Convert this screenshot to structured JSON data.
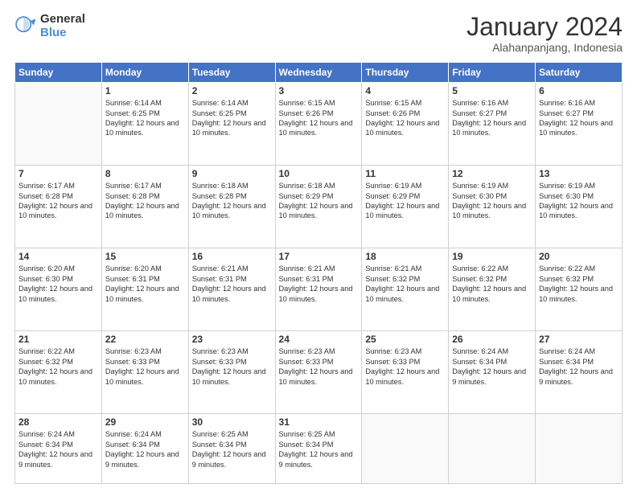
{
  "header": {
    "logo_general": "General",
    "logo_blue": "Blue",
    "month_title": "January 2024",
    "subtitle": "Alahanpanjang, Indonesia"
  },
  "weekdays": [
    "Sunday",
    "Monday",
    "Tuesday",
    "Wednesday",
    "Thursday",
    "Friday",
    "Saturday"
  ],
  "weeks": [
    [
      {
        "day": "",
        "empty": true
      },
      {
        "day": "1",
        "sunrise": "6:14 AM",
        "sunset": "6:25 PM",
        "daylight": "12 hours and 10 minutes."
      },
      {
        "day": "2",
        "sunrise": "6:14 AM",
        "sunset": "6:25 PM",
        "daylight": "12 hours and 10 minutes."
      },
      {
        "day": "3",
        "sunrise": "6:15 AM",
        "sunset": "6:26 PM",
        "daylight": "12 hours and 10 minutes."
      },
      {
        "day": "4",
        "sunrise": "6:15 AM",
        "sunset": "6:26 PM",
        "daylight": "12 hours and 10 minutes."
      },
      {
        "day": "5",
        "sunrise": "6:16 AM",
        "sunset": "6:27 PM",
        "daylight": "12 hours and 10 minutes."
      },
      {
        "day": "6",
        "sunrise": "6:16 AM",
        "sunset": "6:27 PM",
        "daylight": "12 hours and 10 minutes."
      }
    ],
    [
      {
        "day": "7",
        "sunrise": "6:17 AM",
        "sunset": "6:28 PM",
        "daylight": "12 hours and 10 minutes."
      },
      {
        "day": "8",
        "sunrise": "6:17 AM",
        "sunset": "6:28 PM",
        "daylight": "12 hours and 10 minutes."
      },
      {
        "day": "9",
        "sunrise": "6:18 AM",
        "sunset": "6:28 PM",
        "daylight": "12 hours and 10 minutes."
      },
      {
        "day": "10",
        "sunrise": "6:18 AM",
        "sunset": "6:29 PM",
        "daylight": "12 hours and 10 minutes."
      },
      {
        "day": "11",
        "sunrise": "6:19 AM",
        "sunset": "6:29 PM",
        "daylight": "12 hours and 10 minutes."
      },
      {
        "day": "12",
        "sunrise": "6:19 AM",
        "sunset": "6:30 PM",
        "daylight": "12 hours and 10 minutes."
      },
      {
        "day": "13",
        "sunrise": "6:19 AM",
        "sunset": "6:30 PM",
        "daylight": "12 hours and 10 minutes."
      }
    ],
    [
      {
        "day": "14",
        "sunrise": "6:20 AM",
        "sunset": "6:30 PM",
        "daylight": "12 hours and 10 minutes."
      },
      {
        "day": "15",
        "sunrise": "6:20 AM",
        "sunset": "6:31 PM",
        "daylight": "12 hours and 10 minutes."
      },
      {
        "day": "16",
        "sunrise": "6:21 AM",
        "sunset": "6:31 PM",
        "daylight": "12 hours and 10 minutes."
      },
      {
        "day": "17",
        "sunrise": "6:21 AM",
        "sunset": "6:31 PM",
        "daylight": "12 hours and 10 minutes."
      },
      {
        "day": "18",
        "sunrise": "6:21 AM",
        "sunset": "6:32 PM",
        "daylight": "12 hours and 10 minutes."
      },
      {
        "day": "19",
        "sunrise": "6:22 AM",
        "sunset": "6:32 PM",
        "daylight": "12 hours and 10 minutes."
      },
      {
        "day": "20",
        "sunrise": "6:22 AM",
        "sunset": "6:32 PM",
        "daylight": "12 hours and 10 minutes."
      }
    ],
    [
      {
        "day": "21",
        "sunrise": "6:22 AM",
        "sunset": "6:32 PM",
        "daylight": "12 hours and 10 minutes."
      },
      {
        "day": "22",
        "sunrise": "6:23 AM",
        "sunset": "6:33 PM",
        "daylight": "12 hours and 10 minutes."
      },
      {
        "day": "23",
        "sunrise": "6:23 AM",
        "sunset": "6:33 PM",
        "daylight": "12 hours and 10 minutes."
      },
      {
        "day": "24",
        "sunrise": "6:23 AM",
        "sunset": "6:33 PM",
        "daylight": "12 hours and 10 minutes."
      },
      {
        "day": "25",
        "sunrise": "6:23 AM",
        "sunset": "6:33 PM",
        "daylight": "12 hours and 10 minutes."
      },
      {
        "day": "26",
        "sunrise": "6:24 AM",
        "sunset": "6:34 PM",
        "daylight": "12 hours and 9 minutes."
      },
      {
        "day": "27",
        "sunrise": "6:24 AM",
        "sunset": "6:34 PM",
        "daylight": "12 hours and 9 minutes."
      }
    ],
    [
      {
        "day": "28",
        "sunrise": "6:24 AM",
        "sunset": "6:34 PM",
        "daylight": "12 hours and 9 minutes."
      },
      {
        "day": "29",
        "sunrise": "6:24 AM",
        "sunset": "6:34 PM",
        "daylight": "12 hours and 9 minutes."
      },
      {
        "day": "30",
        "sunrise": "6:25 AM",
        "sunset": "6:34 PM",
        "daylight": "12 hours and 9 minutes."
      },
      {
        "day": "31",
        "sunrise": "6:25 AM",
        "sunset": "6:34 PM",
        "daylight": "12 hours and 9 minutes."
      },
      {
        "day": "",
        "empty": true
      },
      {
        "day": "",
        "empty": true
      },
      {
        "day": "",
        "empty": true
      }
    ]
  ]
}
